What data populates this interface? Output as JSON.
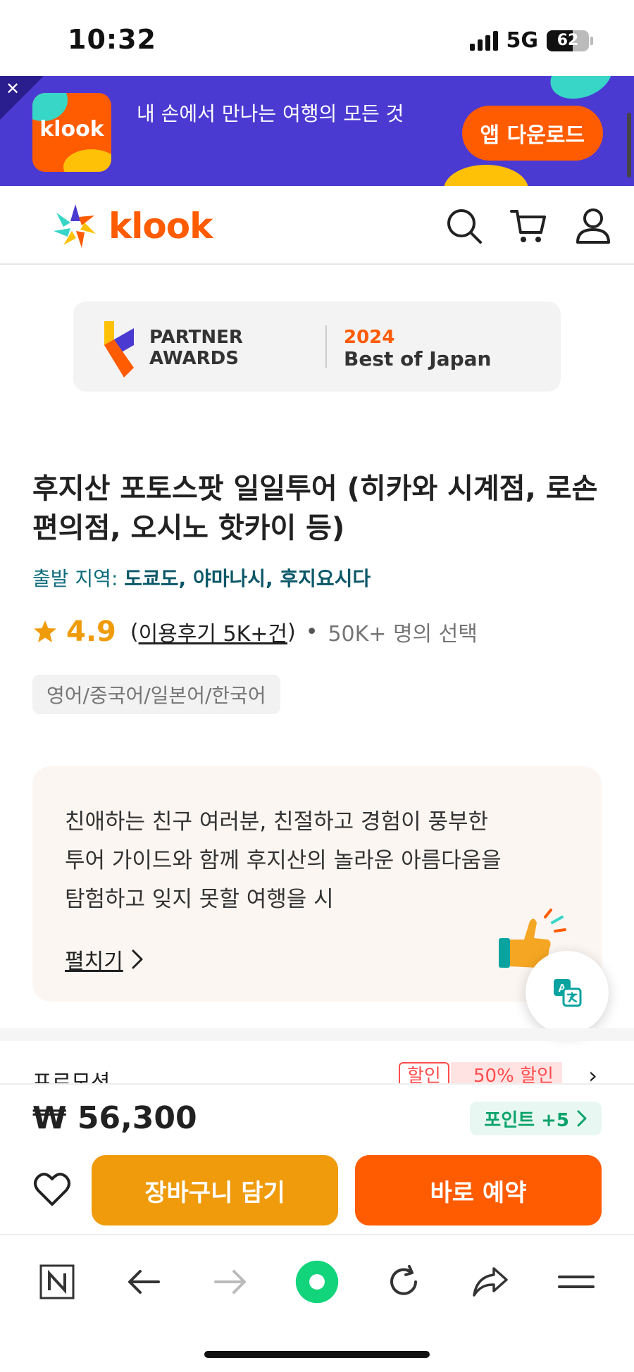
{
  "status_bar": {
    "time": "10:32",
    "network": "5G",
    "battery": "62"
  },
  "app_banner": {
    "logo_text": "klook",
    "message": "내 손에서 만나는 여행의 모든 것",
    "download_label": "앱 다운로드"
  },
  "header": {
    "logo_text": "klook"
  },
  "awards": {
    "line1": "PARTNER",
    "line2": "AWARDS",
    "year": "2024",
    "title": "Best of Japan"
  },
  "product": {
    "title": "후지산 포토스팟 일일투어 (히카와 시계점, 로손 편의점, 오시노 핫카이 등)",
    "departure_label": "출발 지역:",
    "departure_cities": "도쿄도, 야마나시, 후지요시다",
    "rating": "4.9",
    "reviews_open": "(",
    "reviews": "이용후기 5K+건",
    "reviews_close": ")",
    "bookings": "50K+ 명의 선택",
    "languages": "영어/중국어/일본어/한국어"
  },
  "description": {
    "text": "친애하는 친구 여러분, 친절하고 경험이 풍부한 투어 가이드와 함께 후지산의 놀라운 아름다움을 탐험하고 잊지 못할 여행을 시",
    "expand_label": "펼치기"
  },
  "promotion": {
    "label": "프로모션",
    "tag_discount": "할인",
    "tag_percent": "50% 할인"
  },
  "purchase": {
    "price": "₩ 56,300",
    "points": "포인트 +5",
    "cart_label": "장바구니 담기",
    "book_label": "바로 예약"
  },
  "colors": {
    "brand": "#ff5b00",
    "banner": "#4b3ad1",
    "cart": "#ef9b0c",
    "rating": "#f09b0a",
    "points": "#0aa36b"
  }
}
